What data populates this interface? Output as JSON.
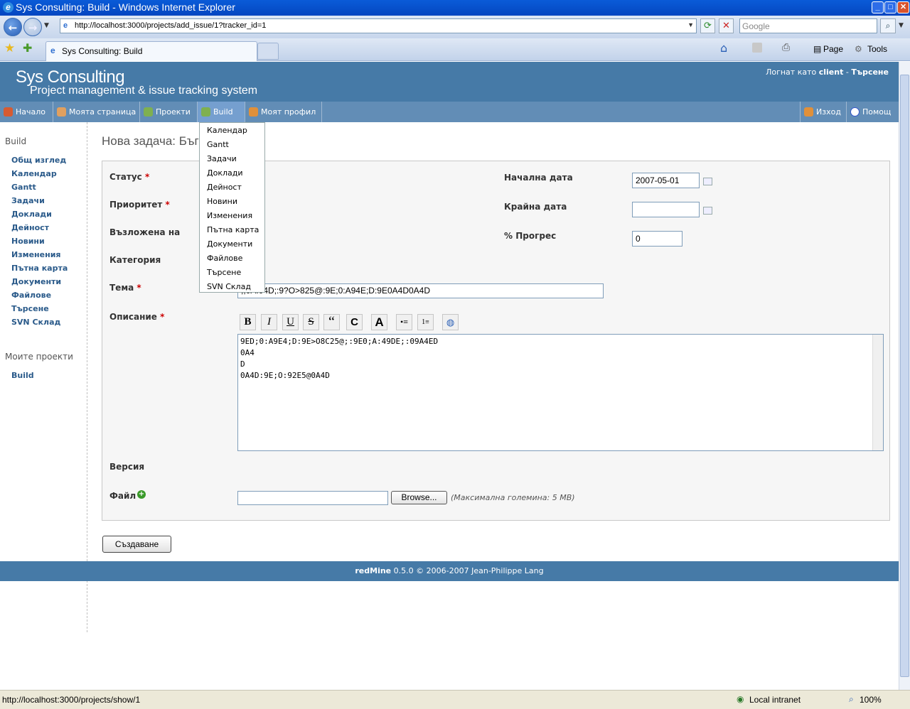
{
  "window": {
    "title": "Sys Consulting: Build - Windows Internet Explorer",
    "minimize": "_",
    "maximize": "□",
    "close": "✕"
  },
  "browser": {
    "url": "http://localhost:3000/projects/add_issue/1?tracker_id=1",
    "search_placeholder": "Google",
    "tab_title": "Sys Consulting: Build",
    "toolbar": {
      "page": "Page",
      "tools": "Tools"
    },
    "status_url": "http://localhost:3000/projects/show/1",
    "zone": "Local intranet",
    "zoom": "100%"
  },
  "header": {
    "title": "Sys Consulting",
    "subtitle": "Project management & issue tracking system",
    "login_prefix": "Логнат като",
    "login_user": "client",
    "login_sep": " - ",
    "search_link": "Търсене"
  },
  "mainmenu": {
    "home": "Начало",
    "mypage": "Моята страница",
    "projects": "Проекти",
    "build": "Build",
    "myaccount": "Моят профил",
    "logout": "Изход",
    "help": "Помощ"
  },
  "dropdown": [
    "Календар",
    "Gantt",
    "Задачи",
    "Доклади",
    "Дейност",
    "Новини",
    "Изменения",
    "Пътна карта",
    "Документи",
    "Файлове",
    "Търсене",
    "SVN Склад"
  ],
  "sidebar": {
    "project_title": "Build",
    "links": [
      "Общ изглед",
      "Календар",
      "Gantt",
      "Задачи",
      "Доклади",
      "Дейност",
      "Новини",
      "Изменения",
      "Пътна карта",
      "Документи",
      "Файлове",
      "Търсене",
      "SVN Склад"
    ],
    "my_projects_title": "Моите проекти",
    "my_projects": [
      "Build"
    ]
  },
  "form": {
    "page_title": "Нова задача: Бъг",
    "status_label": "Статус",
    "priority_label": "Приоритет",
    "assigned_label": "Възложена на",
    "category_label": "Категория",
    "subject_label": "Тема",
    "subject_value": ";;0A:04D;:9?O>825@:9E;0:A94E;D:9E0A4D0A4D",
    "description_label": "Описание",
    "description_lines": [
      "9ED;0:A9E4;D:9E>O8C25@;:9E0;A:49DE;:09A4ED",
      "0A4",
      "D",
      "0A4D:9E;O:92E5@0A4D"
    ],
    "start_date_label": "Начална дата",
    "start_date_value": "2007-05-01",
    "due_date_label": "Крайна дата",
    "due_date_value": "",
    "done_label": "% Прогрес",
    "done_value": "0",
    "version_label": "Версия",
    "file_label": "Файл",
    "browse_label": "Browse...",
    "max_size": "(Максимална големина: 5 MB)",
    "submit_label": "Създаване",
    "required_mark": "*"
  },
  "toolbar_buttons": {
    "bold": "B",
    "italic": "I",
    "underline": "U",
    "strike": "S",
    "quote": "“",
    "code": "C",
    "heading": "A"
  },
  "footer": {
    "app": "redMine",
    "text": " 0.5.0 © 2006-2007 Jean-Philippe Lang"
  },
  "colors": {
    "header": "#467aa7",
    "menu": "#628db6",
    "menu_selected": "#759fcf",
    "link": "#2a5a8a"
  }
}
